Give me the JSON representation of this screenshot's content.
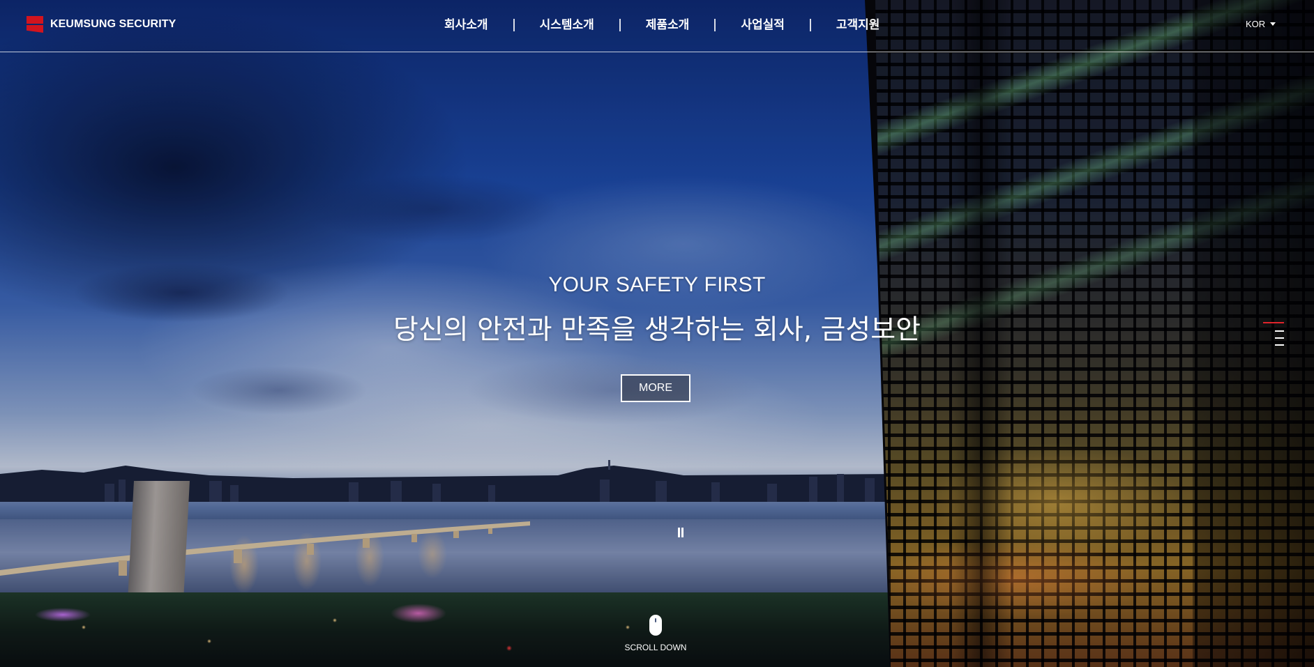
{
  "header": {
    "brand": "KEUMSUNG SECURITY",
    "brand_color": "#d2141e",
    "nav": [
      "회사소개",
      "시스템소개",
      "제품소개",
      "사업실적",
      "고객지원"
    ],
    "language": "KOR"
  },
  "hero": {
    "subtitle": "YOUR SAFETY FIRST",
    "title": "당신의 안전과 만족을 생각하는 회사, 금성보안",
    "more_label": "MORE"
  },
  "slider": {
    "slides": 4,
    "active_slide": 1,
    "active_color": "#e0242b",
    "state": "playing"
  },
  "scroll": {
    "label": "SCROLL DOWN",
    "icon": "mouse-icon"
  }
}
